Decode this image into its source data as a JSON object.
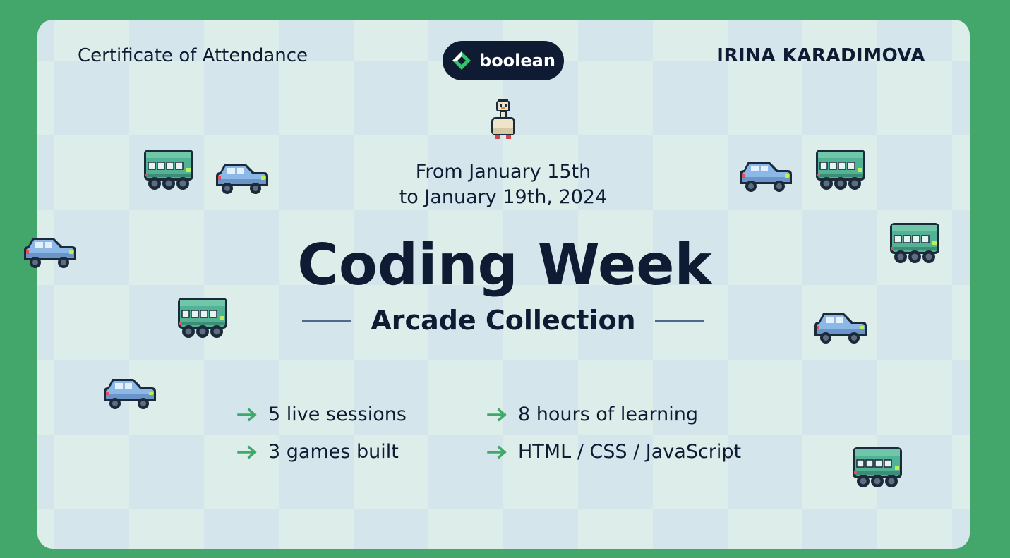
{
  "header": {
    "left": "Certificate of Attendance",
    "right": "IRINA KARADIMOVA"
  },
  "logo": {
    "text": "boolean"
  },
  "dates": {
    "line1": "From January 15th",
    "line2": "to January 19th, 2024"
  },
  "title": "Coding Week",
  "subtitle": "Arcade Collection",
  "features": {
    "f1": "5 live sessions",
    "f2": "8 hours of learning",
    "f3": "3 games built",
    "f4": "HTML / CSS / JavaScript"
  },
  "colors": {
    "background": "#43a66b",
    "ink": "#0e1b33",
    "accent": "#3fa96c",
    "bus": "#4fae8f",
    "car": "#8ab6e3"
  },
  "icons": {
    "logo": "boolean-logo-icon",
    "mascot": "duck-sprite-icon",
    "bullet": "arrow-right-icon",
    "bus": "bus-sprite-icon",
    "car": "car-sprite-icon"
  }
}
